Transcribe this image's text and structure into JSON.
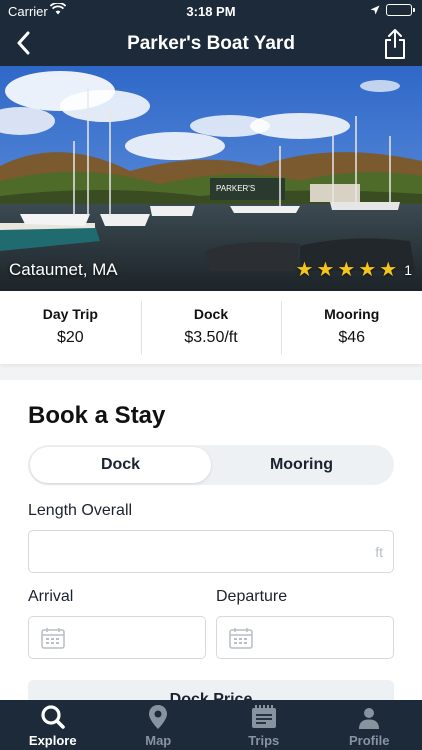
{
  "status": {
    "carrier": "Carrier",
    "time": "3:18 PM"
  },
  "nav": {
    "title": "Parker's Boat Yard"
  },
  "hero": {
    "location": "Cataumet, MA",
    "stars": 5,
    "rating_count": "1",
    "sign_text": "PARKER'S"
  },
  "prices": [
    {
      "label": "Day Trip",
      "value": "$20"
    },
    {
      "label": "Dock",
      "value": "$3.50/ft"
    },
    {
      "label": "Mooring",
      "value": "$46"
    }
  ],
  "book": {
    "title": "Book a Stay",
    "tabs": [
      "Dock",
      "Mooring"
    ],
    "selected_tab": "Dock",
    "length_label": "Length Overall",
    "length_unit": "ft",
    "length_value": "",
    "arrival_label": "Arrival",
    "departure_label": "Departure",
    "price_label": "Dock Price"
  },
  "tabbar": [
    {
      "label": "Explore",
      "icon": "search-icon",
      "active": true
    },
    {
      "label": "Map",
      "icon": "map-pin-icon",
      "active": false
    },
    {
      "label": "Trips",
      "icon": "trips-icon",
      "active": false
    },
    {
      "label": "Profile",
      "icon": "profile-icon",
      "active": false
    }
  ],
  "colors": {
    "nav": "#1c2a3a",
    "star": "#f5c518",
    "battery": "#4cd964"
  }
}
